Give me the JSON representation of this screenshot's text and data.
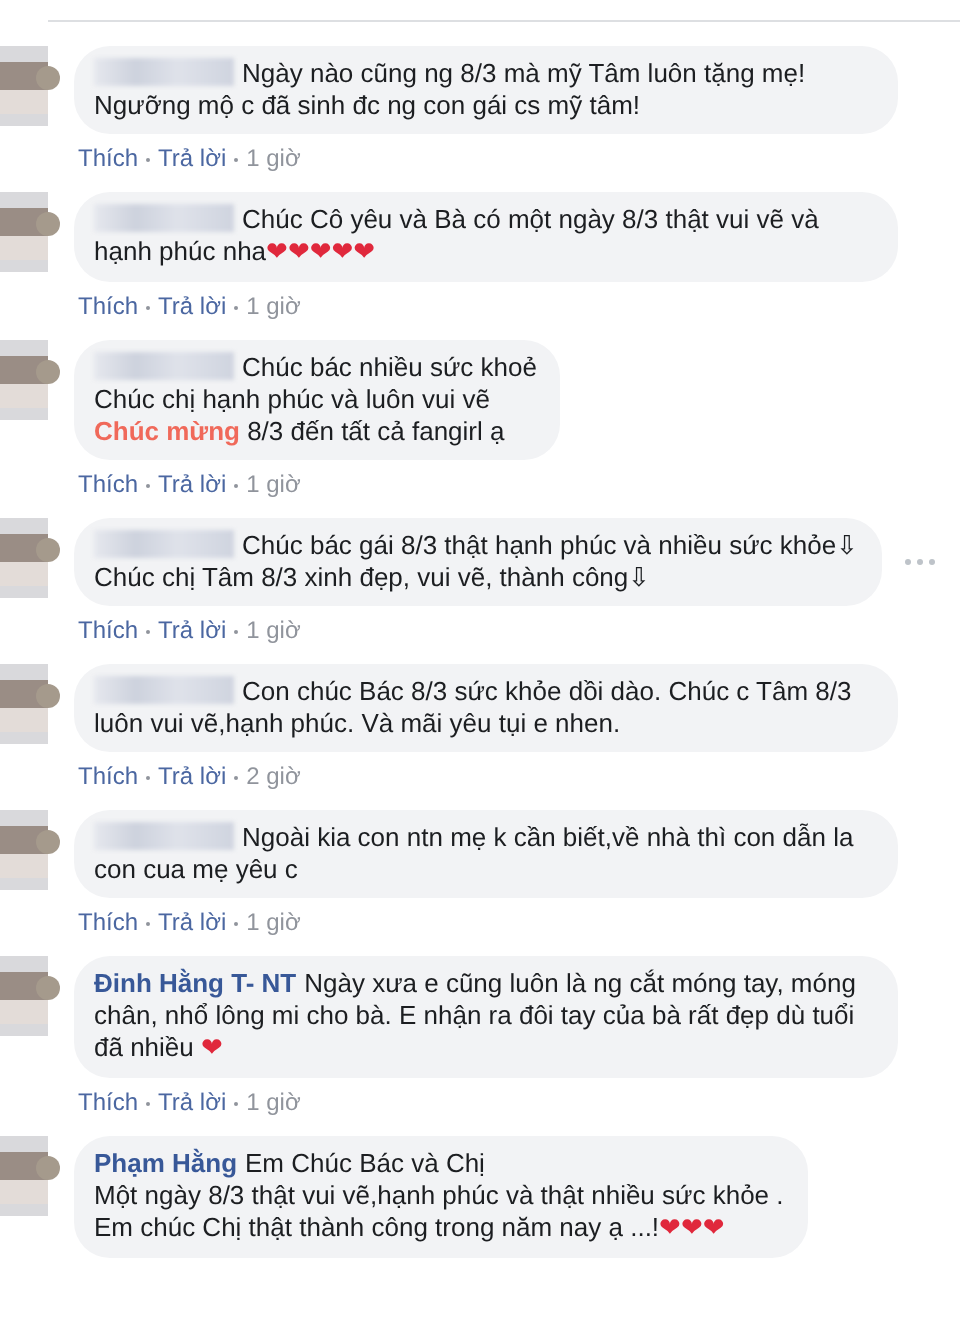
{
  "comments": [
    {
      "text": "Ngày nào cũng ng 8/3 mà mỹ Tâm luôn tặng mẹ! Ngưỡng mộ c đã sinh đc ng con gái cs mỹ tâm!",
      "actions": [
        "Thích",
        "Trả lời"
      ],
      "time": "1 giờ"
    },
    {
      "text": "Chúc Cô yêu và Bà có một ngày 8/3 thật vui vẽ và hạnh phúc nha❤❤❤❤❤",
      "actions": [
        "Thích",
        "Trả lời"
      ],
      "time": "1 giờ"
    },
    {
      "text": "Chúc bác nhiều sức khoẻ\nChúc chị hạnh phúc và luôn vui vẽ\n**Chúc mừng** 8/3 đến tất cả fangirl ạ",
      "actions": [
        "Thích",
        "Trả lời"
      ],
      "time": "1 giờ"
    },
    {
      "text": "Chúc bác gái 8/3 thật hạnh phúc và nhiều sức khỏe⇩\nChúc chị Tâm 8/3 xinh đẹp, vui vẽ, thành công⇩",
      "actions": [
        "Thích",
        "Trả lời"
      ],
      "time": "1 giờ",
      "more_menu": true
    },
    {
      "text": "Con chúc Bác 8/3 sức khỏe dồi dào. Chúc c Tâm 8/3 luôn vui vẽ,hạnh phúc. Và mãi yêu tụi e nhen.",
      "actions": [
        "Thích",
        "Trả lời"
      ],
      "time": "2 giờ"
    },
    {
      "text": "Ngoài kia con ntn mẹ k cần biết,về nhà thì con dẫn la con cua mẹ yêu c",
      "actions": [
        "Thích",
        "Trả lời"
      ],
      "time": "1 giờ"
    },
    {
      "author": "Đinh Hằng T- NT",
      "text": "Ngày xưa e cũng luôn là ng cắt móng tay, móng chân, nhổ lông mi cho bà. E nhận ra đôi tay của bà rất đẹp dù tuổi đã nhiều ❤",
      "actions": [
        "Thích",
        "Trả lời"
      ],
      "time": "1 giờ"
    },
    {
      "author": "Phạm Hằng",
      "text": "Em Chúc Bác và Chị\nMột ngày 8/3 thật vui vẽ,hạnh phúc và thật nhiều sức khỏe .\nEm chúc Chị thật thành công trong năm nay ạ ...!❤❤❤"
    }
  ]
}
